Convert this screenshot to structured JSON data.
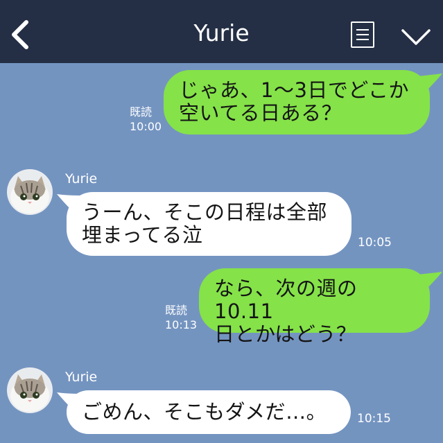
{
  "header": {
    "title": "Yurie"
  },
  "messages": [
    {
      "direction": "outgoing",
      "lines": [
        "じゃあ、1〜3日でどこか",
        "空いてる日ある？"
      ],
      "read": "既読",
      "time": "10:00"
    },
    {
      "direction": "incoming",
      "sender": "Yurie",
      "lines": [
        "うーん、そこの日程は全部",
        "埋まってる泣"
      ],
      "time": "10:05"
    },
    {
      "direction": "outgoing",
      "lines": [
        "なら、次の週の10.11",
        "日とかはどう？"
      ],
      "read": "既読",
      "time": "10:13"
    },
    {
      "direction": "incoming",
      "sender": "Yurie",
      "lines": [
        "ごめん、そこもダメだ…。"
      ],
      "time": "10:15"
    }
  ],
  "colors": {
    "background": "#7494c0",
    "header": "#242f45",
    "outgoing_bubble": "#85e249",
    "incoming_bubble": "#ffffff"
  },
  "icons": {
    "back": "chevron-left-icon",
    "note": "note-icon",
    "menu": "chevron-down-icon",
    "avatar": "cat-avatar"
  }
}
